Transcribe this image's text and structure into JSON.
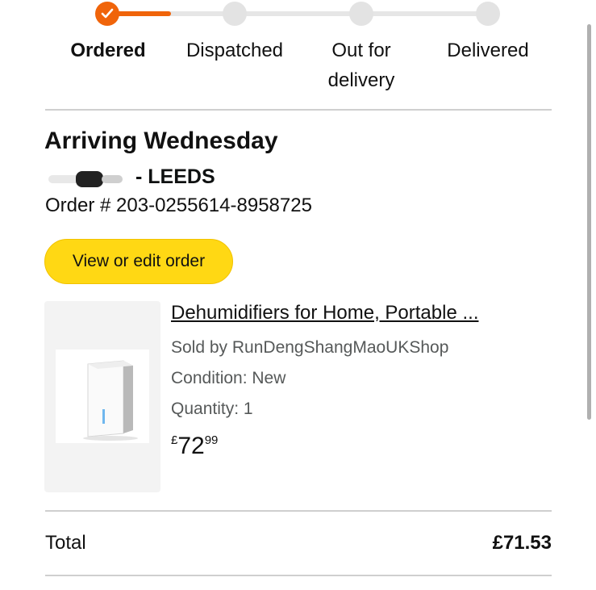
{
  "progress": {
    "steps": [
      {
        "label": "Ordered",
        "state": "complete"
      },
      {
        "label": "Dispatched",
        "state": "pending"
      },
      {
        "label": "Out for\ndelivery",
        "state": "pending"
      },
      {
        "label": "Delivered",
        "state": "pending"
      }
    ],
    "complete_color": "#f0640a",
    "pending_color": "#e3e3e3"
  },
  "shipment": {
    "heading": "Arriving Wednesday",
    "address_city": "- LEEDS",
    "order_number": "Order # 203-0255614-8958725",
    "edit_button_label": "View or edit order",
    "button_color": "#ffd814"
  },
  "item": {
    "title": "Dehumidifiers for Home, Portable ...",
    "sold_by": "Sold by RunDengShangMaoUKShop",
    "condition": "Condition: New",
    "quantity": "Quantity: 1",
    "price_currency": "£",
    "price_whole": "72",
    "price_fraction": "99",
    "image_icon": "dehumidifier-product-image"
  },
  "summary": {
    "total_label": "Total",
    "total_value": "£71.53"
  }
}
